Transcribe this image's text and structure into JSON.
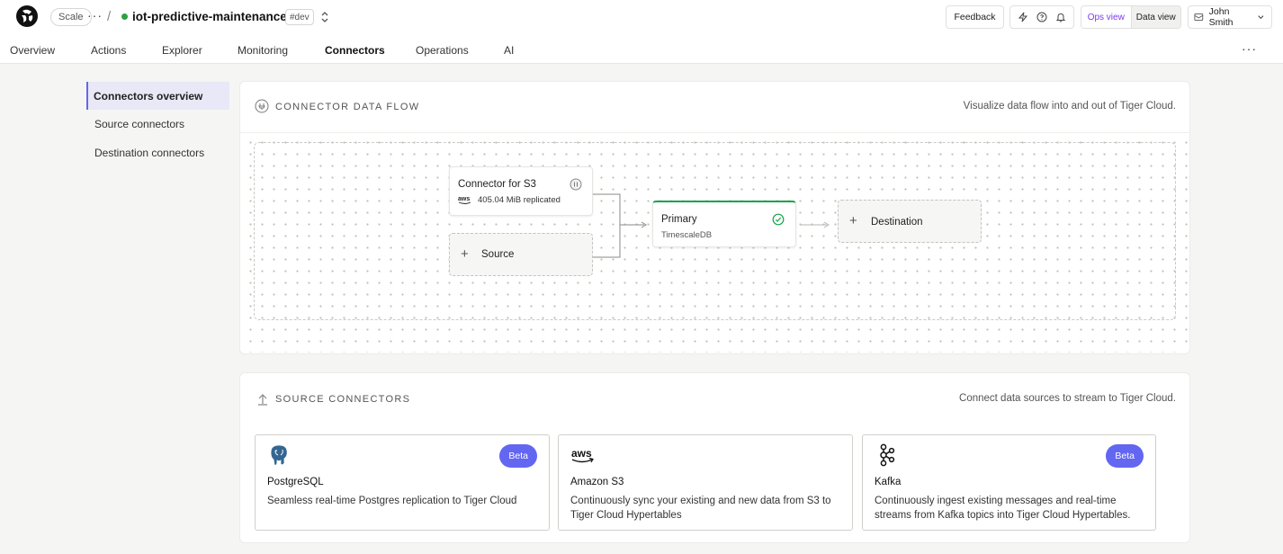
{
  "topbar": {
    "plan_pill": "Scale",
    "service_name": "iot-predictive-maintenance",
    "env_pill": "#dev",
    "feedback": "Feedback",
    "ops_view": "Ops view",
    "data_view": "Data view",
    "user_name": "John Smith",
    "status_color": "#2ea043"
  },
  "tabs": [
    "Overview",
    "Actions",
    "Explorer",
    "Monitoring",
    "Connectors",
    "Operations",
    "AI"
  ],
  "active_tab": "Connectors",
  "sidebar": {
    "items": [
      "Connectors overview",
      "Source connectors",
      "Destination connectors"
    ],
    "active": "Connectors overview"
  },
  "flow": {
    "title": "CONNECTOR DATA FLOW",
    "description": "Visualize data flow into and out of Tiger Cloud.",
    "s3_node": {
      "title": "Connector for S3",
      "sub": "405.04 MiB replicated",
      "logo": "aws"
    },
    "source_node": {
      "label": "Source"
    },
    "primary_node": {
      "title": "Primary",
      "sub": "TimescaleDB"
    },
    "destination_node": {
      "label": "Destination"
    }
  },
  "sources": {
    "title": "SOURCE CONNECTORS",
    "description": "Connect data sources to stream to Tiger Cloud.",
    "cards": [
      {
        "name": "PostgreSQL",
        "desc": "Seamless real-time Postgres replication to Tiger Cloud",
        "badge": "Beta",
        "icon": "postgresql-icon"
      },
      {
        "name": "Amazon S3",
        "desc": "Continuously sync your existing and new data from S3 to Tiger Cloud Hypertables",
        "badge": "",
        "icon": "aws-icon"
      },
      {
        "name": "Kafka",
        "desc": "Continuously ingest existing messages and real-time streams from Kafka topics into Tiger Cloud Hypertables.",
        "badge": "Beta",
        "icon": "kafka-icon"
      }
    ]
  },
  "colors": {
    "accent": "#6366f1",
    "ops_view": "#7c3aed",
    "success": "#16a34a"
  }
}
